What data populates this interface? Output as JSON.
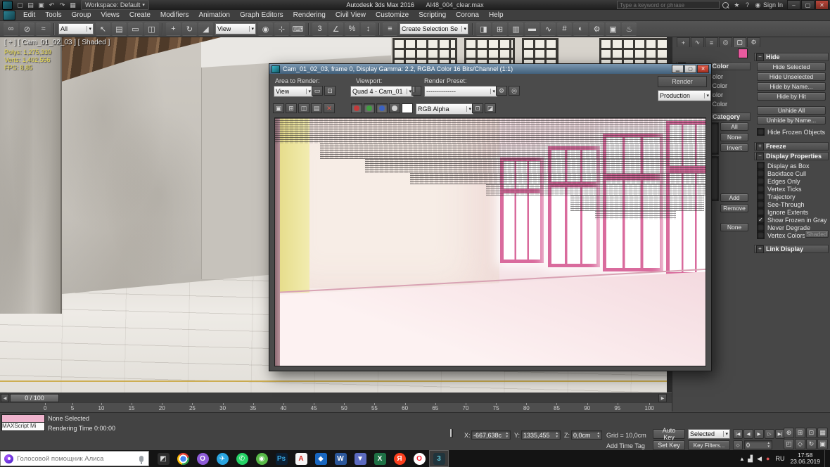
{
  "titlebar": {
    "workspace": "Workspace: Default",
    "app_title": "Autodesk 3ds Max 2016",
    "file_name": "AI48_004_clear.max",
    "search_placeholder": "Type a keyword or phrase",
    "sign_in": "Sign In",
    "icons": [
      {
        "name": "new-scene-icon",
        "g": "▢"
      },
      {
        "name": "open-file-icon",
        "g": "▤"
      },
      {
        "name": "save-file-icon",
        "g": "▣"
      },
      {
        "name": "undo-icon",
        "g": "↶"
      },
      {
        "name": "redo-icon",
        "g": "↷"
      },
      {
        "name": "project-folder-icon",
        "g": "▦"
      }
    ],
    "window_buttons": [
      {
        "name": "minimize-button",
        "g": "–"
      },
      {
        "name": "restore-button",
        "g": "▢"
      },
      {
        "name": "close-button",
        "g": "✕",
        "close": true
      }
    ]
  },
  "menus": [
    "Edit",
    "Tools",
    "Group",
    "Views",
    "Create",
    "Modifiers",
    "Animation",
    "Graph Editors",
    "Rendering",
    "Civil View",
    "Customize",
    "Scripting",
    "Corona",
    "Help"
  ],
  "main_toolbar": {
    "group_link": [
      {
        "name": "select-and-link-icon",
        "g": "∞"
      },
      {
        "name": "unlink-selection-icon",
        "g": "⊘"
      },
      {
        "name": "bind-to-space-warp-icon",
        "g": "≈"
      }
    ],
    "selection_filter_value": "All",
    "group_select": [
      {
        "name": "select-object-icon",
        "g": "↖"
      },
      {
        "name": "select-by-name-icon",
        "g": "▤"
      },
      {
        "name": "selection-region-icon",
        "g": "▭"
      },
      {
        "name": "window-crossing-icon",
        "g": "◫"
      }
    ],
    "group_transform": [
      {
        "name": "select-and-move-icon",
        "g": "+"
      },
      {
        "name": "select-and-rotate-icon",
        "g": "↻"
      },
      {
        "name": "select-and-scale-icon",
        "g": "◢"
      }
    ],
    "coord_system_value": "View",
    "group_pivot": [
      {
        "name": "use-pivot-center-icon",
        "g": "◉"
      },
      {
        "name": "select-and-manipulate-icon",
        "g": "⊹"
      },
      {
        "name": "keyboard-override-icon",
        "g": "⌨"
      }
    ],
    "group_snaps": [
      {
        "name": "snaps-toggle-icon",
        "g": "3"
      },
      {
        "name": "angle-snap-icon",
        "g": "∠"
      },
      {
        "name": "percent-snap-icon",
        "g": "%"
      },
      {
        "name": "spinner-snap-icon",
        "g": "↕"
      }
    ],
    "group_sets": [
      {
        "name": "edit-named-selection-sets-icon",
        "g": "≡"
      }
    ],
    "selection_set_value": "Create Selection Se",
    "group_tools": [
      {
        "name": "mirror-icon",
        "g": "◨"
      },
      {
        "name": "align-icon",
        "g": "⊞"
      },
      {
        "name": "layer-manager-icon",
        "g": "▥"
      },
      {
        "name": "ribbon-icon",
        "g": "▬"
      },
      {
        "name": "curve-editor-icon",
        "g": "∿"
      },
      {
        "name": "schematic-view-icon",
        "g": "#"
      },
      {
        "name": "material-editor-icon",
        "g": "◐"
      },
      {
        "name": "render-setup-icon",
        "g": "⚙"
      },
      {
        "name": "rendered-frame-icon",
        "g": "▣"
      },
      {
        "name": "render-production-icon",
        "g": "♨"
      }
    ]
  },
  "viewport": {
    "label": "[ + ] [ Cam_01_02_03 ] [ Shaded ]",
    "stats": "Polys: 1,275,339\nVerts: 1,402,556\nFPS: 8,85"
  },
  "rfw": {
    "title": "Cam_01_02_03, frame 0, Display Gamma: 2.2, RGBA Color 16 Bits/Channel (1:1)",
    "area_label": "Area to Render:",
    "viewport_label": "Viewport:",
    "preset_label": "Render Preset:",
    "area_value": "View",
    "viewport_value": "Quad 4 - Cam_01",
    "preset_value": "--------------",
    "render_button": "Render",
    "production_value": "Production",
    "channel_value": "RGB Alpha",
    "channel_colors": {
      "r": "#c23b3b",
      "g": "#3f9e3f",
      "b": "#3b62c2"
    }
  },
  "command_panel": {
    "tabs": [
      {
        "name": "tab-create",
        "g": "+"
      },
      {
        "name": "tab-modify",
        "g": "∿"
      },
      {
        "name": "tab-hierarchy",
        "g": "≡"
      },
      {
        "name": "tab-motion",
        "g": "◎"
      },
      {
        "name": "tab-display",
        "g": "▢",
        "active": true
      },
      {
        "name": "tab-utilities",
        "g": "⚙"
      }
    ],
    "swatch_color": "#e85a9e",
    "display_color_header": "Display Color",
    "color_options": [
      {
        "label": "Object Color",
        "selected": true
      },
      {
        "label": "Material Color",
        "selected": false
      },
      {
        "label": "Object Color",
        "selected": false
      },
      {
        "label": "Material Color",
        "selected": true
      }
    ],
    "hide_by_category_header": "Hide by Category",
    "category_buttons": [
      "All",
      "None",
      "Invert"
    ],
    "list_buttons": [
      "Add",
      "Remove"
    ],
    "none_button": "None",
    "hide_header": "Hide",
    "hide_buttons_top": [
      "Hide Selected",
      "Hide Unselected",
      "Hide by Name...",
      "Hide by Hit"
    ],
    "hide_buttons_bottom": [
      "Unhide All",
      "Unhide by Name..."
    ],
    "hide_frozen_label": "Hide Frozen Objects",
    "freeze_header": "Freeze",
    "display_properties_header": "Display Properties",
    "properties": [
      {
        "label": "Display as Box",
        "checked": false
      },
      {
        "label": "Backface Cull",
        "checked": false
      },
      {
        "label": "Edges Only",
        "checked": false
      },
      {
        "label": "Vertex Ticks",
        "checked": false
      },
      {
        "label": "Trajectory",
        "checked": false
      },
      {
        "label": "See-Through",
        "checked": false
      },
      {
        "label": "Ignore Extents",
        "checked": false
      },
      {
        "label": "Show Frozen in Gray",
        "checked": true
      },
      {
        "label": "Never Degrade",
        "checked": false
      },
      {
        "label": "Vertex Colors",
        "checked": false
      }
    ],
    "shaded_button": "Shaded",
    "link_display_header": "Link Display"
  },
  "timeline": {
    "slider_value": "0 / 100",
    "ticks": [
      "0",
      "5",
      "10",
      "15",
      "20",
      "25",
      "30",
      "35",
      "40",
      "45",
      "50",
      "55",
      "60",
      "65",
      "70",
      "75",
      "80",
      "85",
      "90",
      "95",
      "100"
    ]
  },
  "status": {
    "maxscript_label": "MAXScript Mi",
    "selection_status": "None Selected",
    "prompt": "Rendering Time 0:00:00",
    "x_label": "X:",
    "x_value": "-667,638c",
    "y_label": "Y:",
    "y_value": "1335,455",
    "z_label": "Z:",
    "z_value": "0,0cm",
    "grid_label": "Grid = 10,0cm",
    "time_tag": "Add Time Tag",
    "auto_key": "Auto Key",
    "set_key": "Set Key",
    "selected_value": "Selected",
    "key_filters": "Key Filters...",
    "time_value": "0",
    "playback": [
      {
        "name": "go-to-start-button",
        "g": "|◀"
      },
      {
        "name": "previous-frame-button",
        "g": "◀"
      },
      {
        "name": "play-button",
        "g": "▶"
      },
      {
        "name": "next-frame-button",
        "g": "▷"
      },
      {
        "name": "go-to-end-button",
        "g": "▶|"
      }
    ],
    "nav_icons": [
      {
        "name": "zoom-icon",
        "g": "⊕"
      },
      {
        "name": "zoom-all-icon",
        "g": "⊞"
      },
      {
        "name": "zoom-extents-icon",
        "g": "⊡"
      },
      {
        "name": "zoom-region-icon",
        "g": "▦"
      },
      {
        "name": "pan-icon",
        "g": "◰"
      },
      {
        "name": "field-of-view-icon",
        "g": "◇"
      },
      {
        "name": "orbit-icon",
        "g": "↻"
      },
      {
        "name": "maximize-viewport-icon",
        "g": "▣"
      }
    ]
  },
  "taskbar": {
    "search_text": "Голосовой помощник Алиса",
    "icons": [
      {
        "name": "taskbar-app-grid",
        "bg": "#2d2d2d",
        "fg": "#e0e0e0",
        "g": "◩"
      },
      {
        "name": "taskbar-chrome",
        "bg": "radial-gradient(circle at 50% 50%, #4285f4 0 4px, #ffffff 4px 6px, rgba(0,0,0,0) 6px), conic-gradient(from -45deg, #ea4335 0 33%, #34a853 0 66%, #fbbc05 0 100%)",
        "fg": "transparent",
        "g": "",
        "circle": true
      },
      {
        "name": "taskbar-purple-app",
        "bg": "#8e5bd8",
        "fg": "#ffffff",
        "g": "O",
        "circle": true
      },
      {
        "name": "taskbar-telegram",
        "bg": "#2aa5e0",
        "fg": "#ffffff",
        "g": "✈",
        "circle": true
      },
      {
        "name": "taskbar-whatsapp",
        "bg": "#25d366",
        "fg": "#ffffff",
        "g": "✆",
        "circle": true
      },
      {
        "name": "taskbar-green-app",
        "bg": "#58b947",
        "fg": "#ffffff",
        "g": "◉",
        "circle": true
      },
      {
        "name": "taskbar-photoshop",
        "bg": "#0b1f33",
        "fg": "#39a8e0",
        "g": "Ps"
      },
      {
        "name": "taskbar-acrobat",
        "bg": "#f5f5f5",
        "fg": "#d6281e",
        "g": "A"
      },
      {
        "name": "taskbar-blue-app",
        "bg": "#1967c0",
        "fg": "#ffffff",
        "g": "◆"
      },
      {
        "name": "taskbar-word",
        "bg": "#2b579a",
        "fg": "#ffffff",
        "g": "W"
      },
      {
        "name": "taskbar-save-app",
        "bg": "#5c6bc0",
        "fg": "#ffffff",
        "g": "▼"
      },
      {
        "name": "taskbar-excel",
        "bg": "#1e7145",
        "fg": "#ffffff",
        "g": "X"
      },
      {
        "name": "taskbar-yandex",
        "bg": "#fc3f1d",
        "fg": "#ffffff",
        "g": "Я",
        "circle": true
      },
      {
        "name": "taskbar-opera",
        "bg": "#ffffff",
        "fg": "#ff1b2d",
        "g": "O",
        "circle": true
      },
      {
        "name": "taskbar-3dsmax",
        "bg": "#20343c",
        "fg": "#5ec4d4",
        "g": "3",
        "active": true
      }
    ],
    "tray_icons": [
      {
        "name": "tray-expand-icon",
        "g": "▴"
      },
      {
        "name": "tray-network-icon",
        "g": "▟"
      },
      {
        "name": "tray-volume-icon",
        "g": "◀"
      },
      {
        "name": "tray-alert-icon",
        "g": "●",
        "fg": "#e05555"
      }
    ],
    "tray": {
      "lang": "RU",
      "time": "17:58",
      "date": "23.06.2019"
    }
  }
}
